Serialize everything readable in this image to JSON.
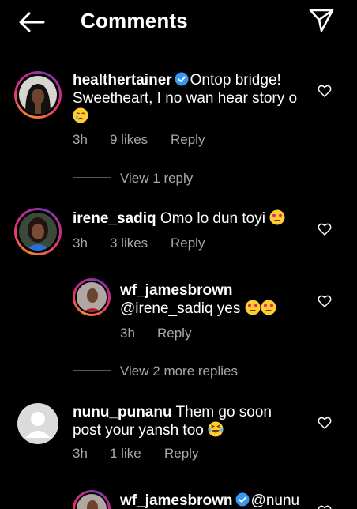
{
  "header": {
    "title": "Comments"
  },
  "comments": [
    {
      "username": "healthertainer",
      "verified": true,
      "text_line1": "Ontop bridge!",
      "text_line2": "Sweetheart, I no wan hear story o",
      "emoji": "crying-face",
      "time": "3h",
      "likes": "9 likes",
      "reply": "Reply",
      "view_replies": "View 1 reply"
    },
    {
      "username": "irene_sadiq",
      "text": "Omo lo dun toyi",
      "emoji": "heart-eyes",
      "time": "3h",
      "likes": "3 likes",
      "reply": "Reply",
      "replies": [
        {
          "username": "wf_jamesbrown",
          "text": "@irene_sadiq yes",
          "emoji": "heart-eyes x2",
          "time": "3h",
          "reply": "Reply"
        }
      ],
      "view_replies": "View 2 more replies"
    },
    {
      "username": "nunu_punanu",
      "text_line1": "Them go soon",
      "text_line2": "post your yansh too",
      "emoji": "laughing-tears",
      "time": "3h",
      "likes": "1 like",
      "reply": "Reply"
    },
    {
      "username": "wf_jamesbrown",
      "verified": true,
      "text": "@nunu"
    }
  ],
  "colors": {
    "background": "#000000",
    "secondary_text": "#a8a8a8",
    "verified": "#3897f0"
  }
}
